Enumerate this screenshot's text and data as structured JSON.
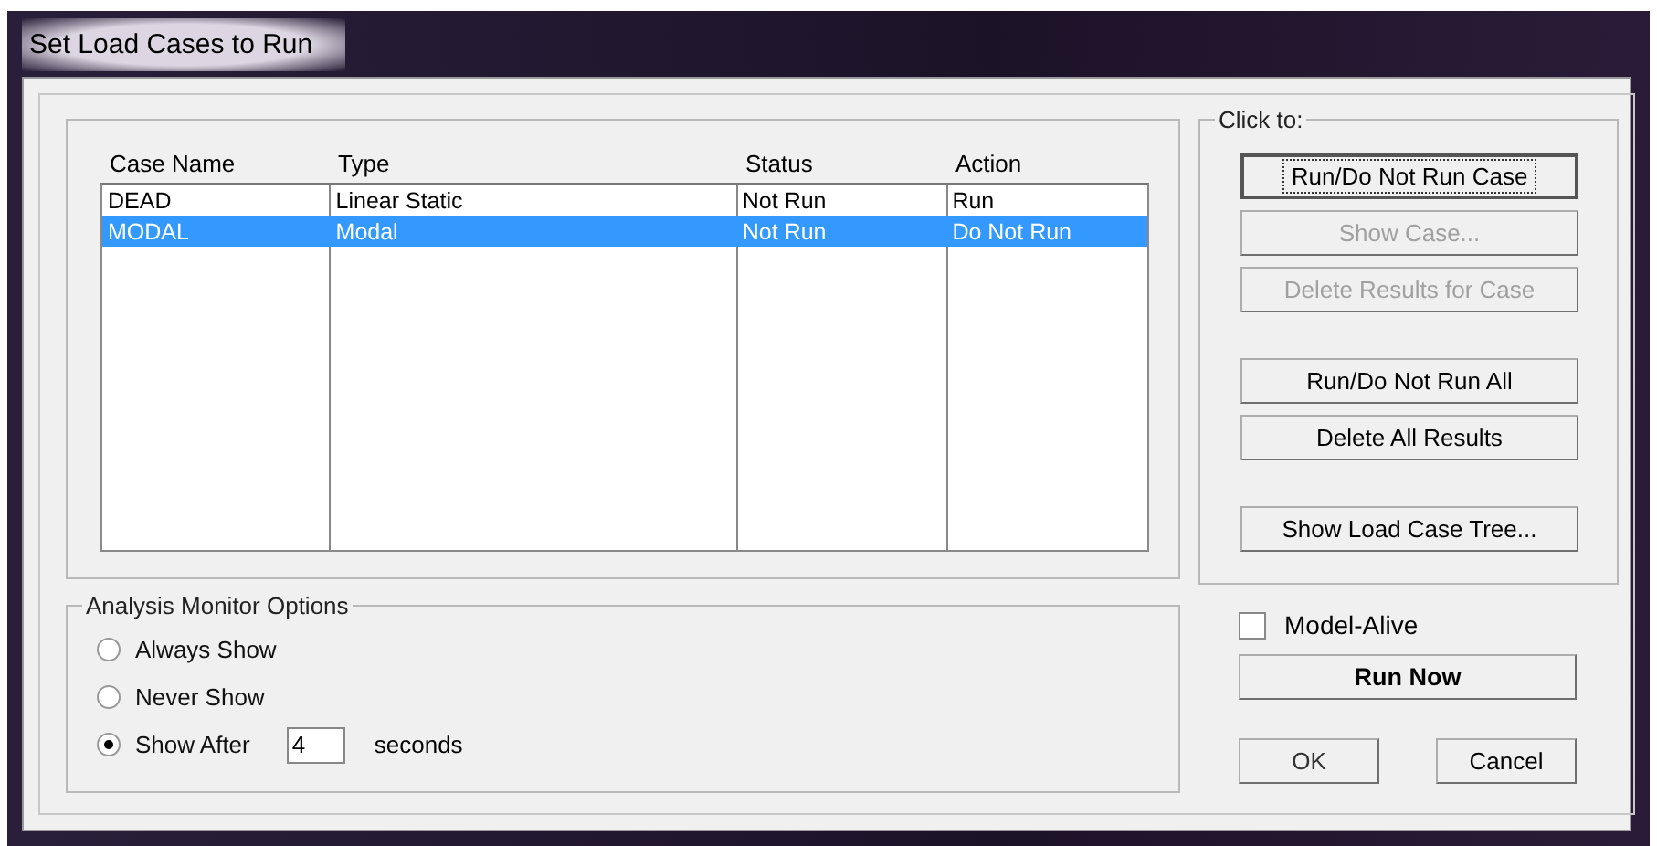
{
  "window": {
    "title": "Set Load Cases to Run"
  },
  "table": {
    "columns": [
      "Case Name",
      "Type",
      "Status",
      "Action"
    ],
    "rows": [
      {
        "cells": [
          "DEAD",
          "Linear Static",
          "Not Run",
          "Run"
        ],
        "selected": false
      },
      {
        "cells": [
          "MODAL",
          "Modal",
          "Not Run",
          "Do Not Run"
        ],
        "selected": true
      }
    ]
  },
  "click_to": {
    "title": "Click to:",
    "groups": [
      {
        "buttons": [
          {
            "label": "Run/Do Not Run Case",
            "disabled": false,
            "focused": true
          },
          {
            "label": "Show Case...",
            "disabled": true,
            "focused": false
          },
          {
            "label": "Delete Results for Case",
            "disabled": true,
            "focused": false
          }
        ]
      },
      {
        "buttons": [
          {
            "label": "Run/Do Not Run All",
            "disabled": false,
            "focused": false
          },
          {
            "label": "Delete All Results",
            "disabled": false,
            "focused": false
          }
        ]
      },
      {
        "buttons": [
          {
            "label": "Show Load Case Tree...",
            "disabled": false,
            "focused": false
          }
        ]
      }
    ]
  },
  "monitor": {
    "title": "Analysis Monitor Options",
    "options": [
      {
        "label": "Always Show",
        "selected": false
      },
      {
        "label": "Never Show",
        "selected": false
      },
      {
        "label": "Show After",
        "selected": true
      }
    ],
    "delay": {
      "value": "4",
      "unit": "seconds"
    }
  },
  "model_alive": {
    "label": "Model-Alive",
    "checked": false
  },
  "run_now": "Run Now",
  "buttons": [
    "OK",
    "Cancel"
  ]
}
